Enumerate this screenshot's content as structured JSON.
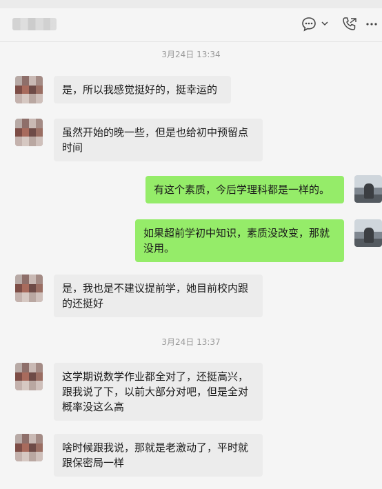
{
  "header": {
    "chat_icon": "chat-bubble-icon",
    "call_icon": "phone-icon",
    "more_icon": "more-dots-icon"
  },
  "timestamps": [
    "3月24日 13:34",
    "3月24日 13:37"
  ],
  "messages": [
    {
      "side": "left",
      "text": "是，所以我感觉挺好的，挺幸运的"
    },
    {
      "side": "left",
      "text": "虽然开始的晚一些，但是也给初中预留点时间"
    },
    {
      "side": "right",
      "text": "有这个素质，今后学理科都是一样的。"
    },
    {
      "side": "right",
      "text": "如果超前学初中知识，素质没改变，那就没用。"
    },
    {
      "side": "left",
      "text": "是，我也是不建议提前学，她目前校内跟的还挺好"
    },
    {
      "side": "left",
      "text": "这学期说数学作业都全对了，还挺高兴，跟我说了下，以前大部分对吧，但是全对概率没这么高"
    },
    {
      "side": "left",
      "text": "啥时候跟我说，那就是老激动了，平时就跟保密局一样"
    }
  ],
  "colors": {
    "background": "#f5f5f5",
    "incoming_bubble": "#ececec",
    "outgoing_bubble": "#95ec69",
    "timestamp_text": "#9a9a9a"
  }
}
